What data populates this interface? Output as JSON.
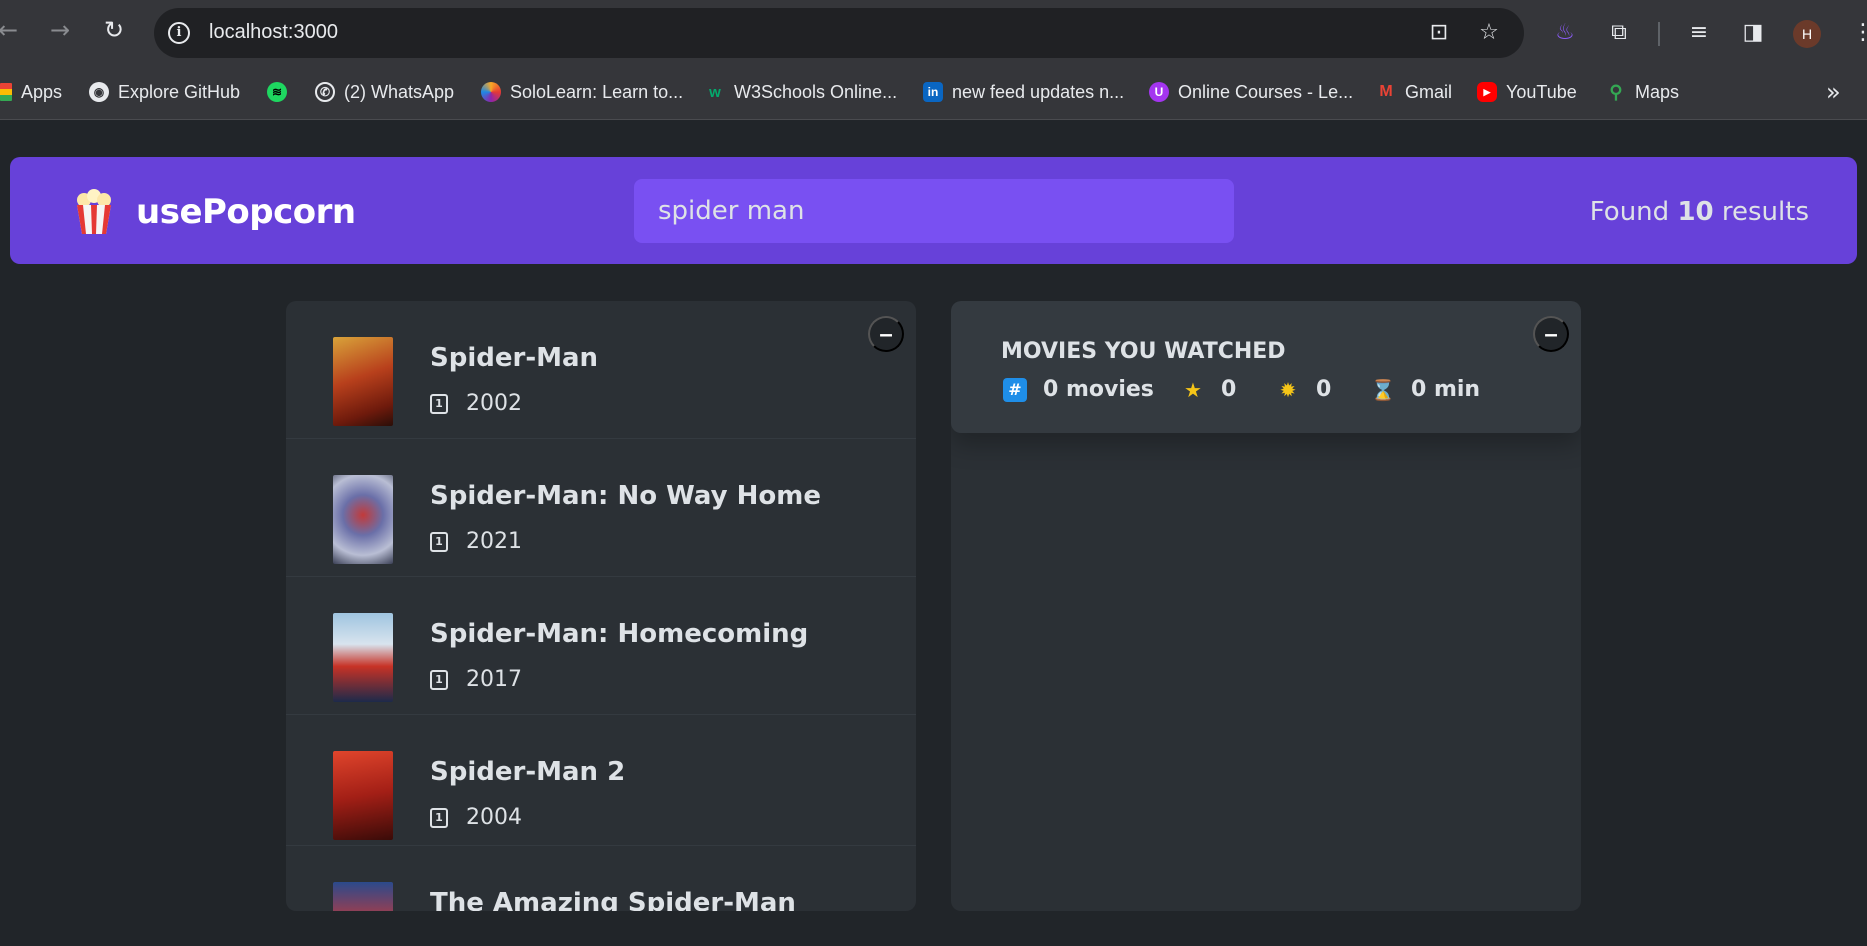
{
  "browser": {
    "url": "localhost:3000",
    "profile_initial": "H",
    "bookmarks": [
      {
        "label": "Apps",
        "icon": "apps-grid-icon"
      },
      {
        "label": "Explore GitHub",
        "icon": "github-icon"
      },
      {
        "label": "",
        "icon": "spotify-icon"
      },
      {
        "label": "(2) WhatsApp",
        "icon": "whatsapp-icon"
      },
      {
        "label": "SoloLearn: Learn to...",
        "icon": "sololearn-icon"
      },
      {
        "label": "W3Schools Online...",
        "icon": "w3schools-icon"
      },
      {
        "label": "new feed updates n...",
        "icon": "linkedin-icon"
      },
      {
        "label": "Online Courses - Le...",
        "icon": "udemy-icon"
      },
      {
        "label": "Gmail",
        "icon": "gmail-icon"
      },
      {
        "label": "YouTube",
        "icon": "youtube-icon"
      },
      {
        "label": "Maps",
        "icon": "maps-icon"
      }
    ]
  },
  "navbar": {
    "logo_text": "usePopcorn",
    "search_value": "spider man",
    "results_prefix": "Found ",
    "results_count": "10",
    "results_suffix": " results"
  },
  "movies": [
    {
      "title": "Spider-Man",
      "year": "2002"
    },
    {
      "title": "Spider-Man: No Way Home",
      "year": "2021"
    },
    {
      "title": "Spider-Man: Homecoming",
      "year": "2017"
    },
    {
      "title": "Spider-Man 2",
      "year": "2004"
    },
    {
      "title": "The Amazing Spider-Man",
      "year": ""
    }
  ],
  "toggle_label": "–",
  "watched": {
    "title": "MOVIES YOU WATCHED",
    "movies_count": "0 movies",
    "imdb_rating": "0",
    "user_rating": "0",
    "runtime": "0 min"
  },
  "colors": {
    "navbar": "#6741d9",
    "search": "#7950f2",
    "background": "#212529",
    "box": "#2b3035",
    "summary": "#343a40"
  }
}
